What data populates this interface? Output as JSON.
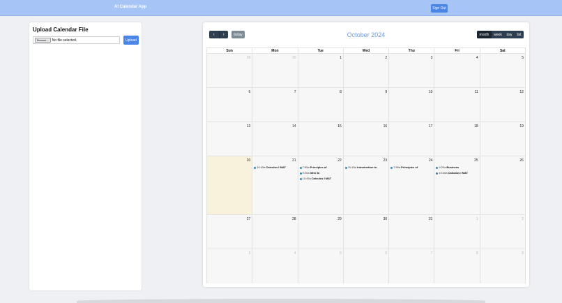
{
  "header": {
    "app_title": "AI Calendar App",
    "signout_label": "Sign Out"
  },
  "upload": {
    "title": "Upload Calendar File",
    "browse_label": "Browse...",
    "file_status": "No file selected.",
    "upload_label": "Upload"
  },
  "calendar": {
    "prev_icon": "chevron-left-icon",
    "next_icon": "chevron-right-icon",
    "prev_glyph": "‹",
    "next_glyph": "›",
    "today_label": "today",
    "title": "October 2024",
    "views": [
      {
        "label": "month",
        "active": true
      },
      {
        "label": "week",
        "active": false
      },
      {
        "label": "day",
        "active": false
      },
      {
        "label": "list",
        "active": false
      }
    ],
    "weekdays": [
      "Sun",
      "Mon",
      "Tue",
      "Wed",
      "Thu",
      "Fri",
      "Sat"
    ],
    "event_color": "#3a87ad",
    "today_color": "#f8f1db",
    "weeks": [
      {
        "days": [
          {
            "num": "29",
            "other": true,
            "events": []
          },
          {
            "num": "30",
            "other": true,
            "events": []
          },
          {
            "num": "1",
            "other": false,
            "events": []
          },
          {
            "num": "2",
            "other": false,
            "events": []
          },
          {
            "num": "3",
            "other": false,
            "events": []
          },
          {
            "num": "4",
            "other": false,
            "events": []
          },
          {
            "num": "5",
            "other": false,
            "events": []
          }
        ]
      },
      {
        "days": [
          {
            "num": "6",
            "other": false,
            "events": []
          },
          {
            "num": "7",
            "other": false,
            "events": []
          },
          {
            "num": "8",
            "other": false,
            "events": []
          },
          {
            "num": "9",
            "other": false,
            "events": []
          },
          {
            "num": "10",
            "other": false,
            "events": []
          },
          {
            "num": "11",
            "other": false,
            "events": []
          },
          {
            "num": "12",
            "other": false,
            "events": []
          }
        ]
      },
      {
        "days": [
          {
            "num": "13",
            "other": false,
            "events": []
          },
          {
            "num": "14",
            "other": false,
            "events": []
          },
          {
            "num": "15",
            "other": false,
            "events": []
          },
          {
            "num": "16",
            "other": false,
            "events": []
          },
          {
            "num": "17",
            "other": false,
            "events": []
          },
          {
            "num": "18",
            "other": false,
            "events": []
          },
          {
            "num": "19",
            "other": false,
            "events": []
          }
        ]
      },
      {
        "days": [
          {
            "num": "20",
            "other": false,
            "today": true,
            "events": []
          },
          {
            "num": "21",
            "other": false,
            "events": [
              {
                "time": "10:45a",
                "title": "Calculus I MAT"
              }
            ]
          },
          {
            "num": "22",
            "other": false,
            "events": [
              {
                "time": "7:55a",
                "title": "Principles of"
              },
              {
                "time": "9:20a",
                "title": "Intro to"
              },
              {
                "time": "10:45a",
                "title": "Calculus I MAT"
              }
            ]
          },
          {
            "num": "23",
            "other": false,
            "events": [
              {
                "time": "10:45a",
                "title": "Introduction to"
              }
            ]
          },
          {
            "num": "24",
            "other": false,
            "events": [
              {
                "time": "7:55a",
                "title": "Principles of"
              }
            ]
          },
          {
            "num": "25",
            "other": false,
            "events": [
              {
                "time": "9:20a",
                "title": "Business"
              },
              {
                "time": "10:45a",
                "title": "Calculus I MAT"
              }
            ]
          },
          {
            "num": "26",
            "other": false,
            "events": []
          }
        ]
      },
      {
        "days": [
          {
            "num": "27",
            "other": false,
            "events": []
          },
          {
            "num": "28",
            "other": false,
            "events": []
          },
          {
            "num": "29",
            "other": false,
            "events": []
          },
          {
            "num": "30",
            "other": false,
            "events": []
          },
          {
            "num": "31",
            "other": false,
            "events": []
          },
          {
            "num": "1",
            "other": true,
            "events": []
          },
          {
            "num": "2",
            "other": true,
            "events": []
          }
        ]
      },
      {
        "days": [
          {
            "num": "3",
            "other": true,
            "events": []
          },
          {
            "num": "4",
            "other": true,
            "events": []
          },
          {
            "num": "5",
            "other": true,
            "events": []
          },
          {
            "num": "6",
            "other": true,
            "events": []
          },
          {
            "num": "7",
            "other": true,
            "events": []
          },
          {
            "num": "8",
            "other": true,
            "events": []
          },
          {
            "num": "9",
            "other": true,
            "events": []
          }
        ]
      }
    ]
  }
}
